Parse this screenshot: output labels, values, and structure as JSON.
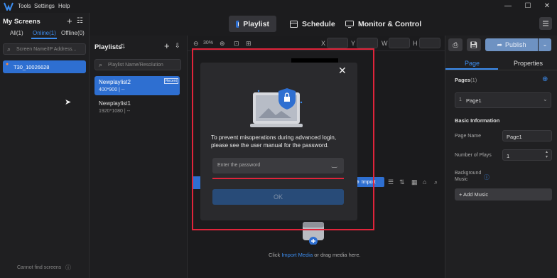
{
  "menu": {
    "tools": "Tools",
    "settings": "Settings",
    "help": "Help"
  },
  "window": {
    "minimize": "—",
    "maximize": "☐",
    "close": "✕"
  },
  "nav": {
    "playlist": "Playlist",
    "schedule": "Schedule",
    "monitor": "Monitor & Control"
  },
  "screens": {
    "title": "My Screens",
    "tabs": [
      "All(1)",
      "Online(1)",
      "Offline(0)"
    ],
    "search_placeholder": "Screen Name/IP Address...",
    "item": "T30_10026628",
    "footer": "Cannot find screens"
  },
  "playlists": {
    "title": "Playlists",
    "search_placeholder": "Playlist Name/Resolution",
    "items": [
      {
        "name": "Newplaylist2",
        "res": "400*900 | --",
        "badge": "Recent"
      },
      {
        "name": "Newplaylist1",
        "res": "1920*1080 | --"
      }
    ]
  },
  "toolbar": {
    "zoom": "30%",
    "x": "X",
    "y": "Y",
    "w": "W",
    "h": "H"
  },
  "media": {
    "import": "Import",
    "hint_prefix": "Click ",
    "hint_link": "Import Media",
    "hint_suffix": " or drag media here."
  },
  "right": {
    "publish": "Publish",
    "tabs": [
      "Page",
      "Properties"
    ],
    "pages_label": "Pages",
    "pages_count": "(1)",
    "page_index": "1",
    "page_name": "Page1",
    "basic_info": "Basic Information",
    "page_name_label": "Page Name",
    "page_name_value": "Page1",
    "plays_label": "Number of Plays",
    "plays_value": "1",
    "bg_music_label_1": "Background",
    "bg_music_label_2": "Music",
    "add_music": "+ Add Music"
  },
  "dialog": {
    "message": "To prevent misoperations during advanced login, please see the user manual for the password.",
    "password_placeholder": "Enter the password",
    "ok": "OK"
  },
  "colors": {
    "accent": "#2e6fd1",
    "highlight": "#e0243a"
  }
}
